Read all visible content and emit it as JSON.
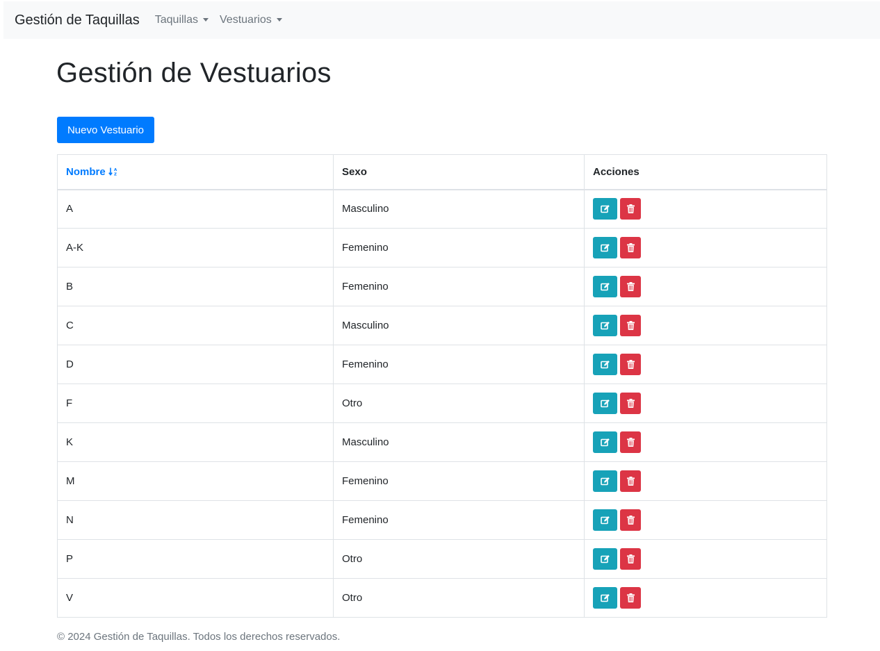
{
  "navbar": {
    "brand": "Gestión de Taquillas",
    "menus": [
      {
        "label": "Taquillas"
      },
      {
        "label": "Vestuarios"
      }
    ]
  },
  "page": {
    "title": "Gestión de Vestuarios",
    "new_button": "Nuevo Vestuario"
  },
  "table": {
    "headers": {
      "nombre": "Nombre",
      "sexo": "Sexo",
      "acciones": "Acciones"
    },
    "sort": {
      "column": "nombre",
      "direction": "ascending"
    },
    "rows": [
      {
        "nombre": "A",
        "sexo": "Masculino"
      },
      {
        "nombre": "A-K",
        "sexo": "Femenino"
      },
      {
        "nombre": "B",
        "sexo": "Femenino"
      },
      {
        "nombre": "C",
        "sexo": "Masculino"
      },
      {
        "nombre": "D",
        "sexo": "Femenino"
      },
      {
        "nombre": "F",
        "sexo": "Otro"
      },
      {
        "nombre": "K",
        "sexo": "Masculino"
      },
      {
        "nombre": "M",
        "sexo": "Femenino"
      },
      {
        "nombre": "N",
        "sexo": "Femenino"
      },
      {
        "nombre": "P",
        "sexo": "Otro"
      },
      {
        "nombre": "V",
        "sexo": "Otro"
      }
    ],
    "row_actions": [
      {
        "name": "edit",
        "icon": "edit-icon",
        "color": "#17a2b8"
      },
      {
        "name": "delete",
        "icon": "trash-icon",
        "color": "#dc3545"
      }
    ]
  },
  "footer": {
    "text": "© 2024 Gestión de Taquillas. Todos los derechos reservados."
  },
  "colors": {
    "primary": "#007bff",
    "info": "#17a2b8",
    "danger": "#dc3545",
    "navbar_bg": "#f8f9fa",
    "muted": "#6c757d"
  }
}
